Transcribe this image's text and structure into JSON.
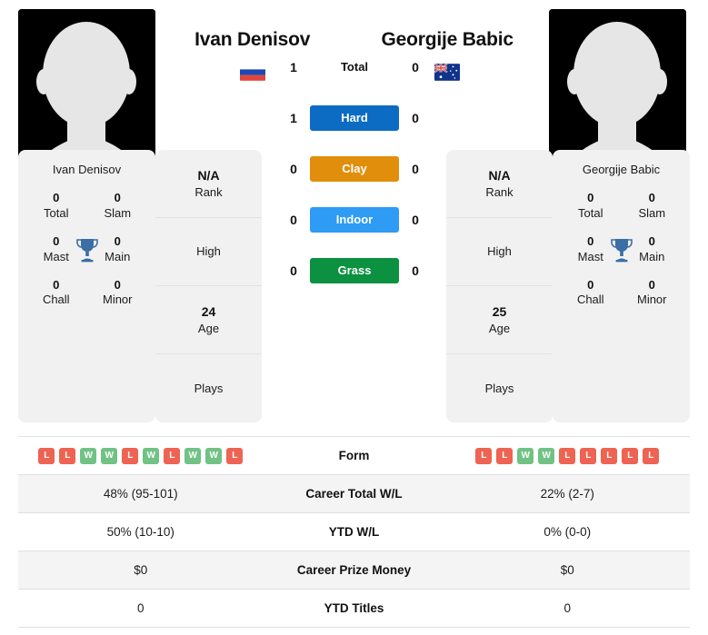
{
  "players": {
    "left": {
      "name": "Ivan Denisov",
      "flag": "russia-flag",
      "avatar": "player-avatar-placeholder",
      "info": [
        {
          "value": "N/A",
          "key": "Rank"
        },
        {
          "value": "",
          "key": "High"
        },
        {
          "value": "24",
          "key": "Age"
        },
        {
          "value": "",
          "key": "Plays"
        }
      ],
      "titles": {
        "name": "Ivan Denisov",
        "cells": [
          {
            "num": "0",
            "key": "Total"
          },
          {
            "num": "0",
            "key": "Slam"
          },
          {
            "num": "0",
            "key": "Mast"
          },
          {
            "num": "0",
            "key": "Main"
          },
          {
            "num": "0",
            "key": "Chall"
          },
          {
            "num": "0",
            "key": "Minor"
          }
        ]
      },
      "form": [
        "L",
        "L",
        "W",
        "W",
        "L",
        "W",
        "L",
        "W",
        "W",
        "L"
      ],
      "career_total_wl": "48% (95-101)",
      "ytd_wl": "50% (10-10)",
      "career_prize_money": "$0",
      "ytd_titles": "0"
    },
    "right": {
      "name": "Georgije Babic",
      "flag": "australia-flag",
      "avatar": "player-avatar-placeholder",
      "info": [
        {
          "value": "N/A",
          "key": "Rank"
        },
        {
          "value": "",
          "key": "High"
        },
        {
          "value": "25",
          "key": "Age"
        },
        {
          "value": "",
          "key": "Plays"
        }
      ],
      "titles": {
        "name": "Georgije Babic",
        "cells": [
          {
            "num": "0",
            "key": "Total"
          },
          {
            "num": "0",
            "key": "Slam"
          },
          {
            "num": "0",
            "key": "Mast"
          },
          {
            "num": "0",
            "key": "Main"
          },
          {
            "num": "0",
            "key": "Chall"
          },
          {
            "num": "0",
            "key": "Minor"
          }
        ]
      },
      "form": [
        "L",
        "L",
        "W",
        "W",
        "L",
        "L",
        "L",
        "L",
        "L"
      ],
      "career_total_wl": "22% (2-7)",
      "ytd_wl": "0% (0-0)",
      "career_prize_money": "$0",
      "ytd_titles": "0"
    }
  },
  "head_to_head": [
    {
      "label": "Total",
      "left": "1",
      "right": "0",
      "style": "plain",
      "color": ""
    },
    {
      "label": "Hard",
      "left": "1",
      "right": "0",
      "style": "bar",
      "color": "#0c6cc4"
    },
    {
      "label": "Clay",
      "left": "0",
      "right": "0",
      "style": "bar",
      "color": "#e08e0b"
    },
    {
      "label": "Indoor",
      "left": "0",
      "right": "0",
      "style": "bar",
      "color": "#2e9bf5"
    },
    {
      "label": "Grass",
      "left": "0",
      "right": "0",
      "style": "bar",
      "color": "#0b9140"
    }
  ],
  "stats_rows": [
    {
      "label": "Form",
      "type": "form"
    },
    {
      "label": "Career Total W/L",
      "type": "text",
      "field": "career_total_wl"
    },
    {
      "label": "YTD W/L",
      "type": "text",
      "field": "ytd_wl"
    },
    {
      "label": "Career Prize Money",
      "type": "text",
      "field": "career_prize_money"
    },
    {
      "label": "YTD Titles",
      "type": "text",
      "field": "ytd_titles"
    }
  ],
  "colors": {
    "win_badge": "#71c285",
    "loss_badge": "#ee6352",
    "trophy": "#3a6ea5",
    "card_bg": "#f1f1f1",
    "row_alt_bg": "#f4f4f4"
  }
}
